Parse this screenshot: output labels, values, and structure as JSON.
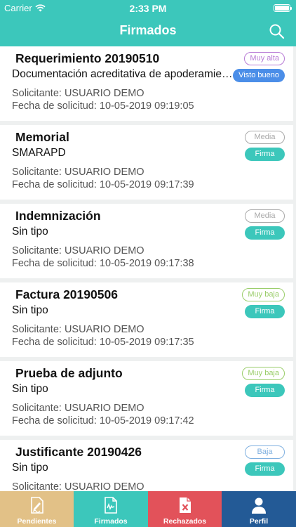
{
  "status_bar": {
    "carrier": "Carrier",
    "time": "2:33 PM"
  },
  "nav": {
    "title": "Firmados",
    "search_icon": "search-icon"
  },
  "colors": {
    "teal": "#3cc7bb",
    "blue": "#4b8ee8",
    "pendientes": "#e2c187",
    "firmados": "#3cc7bb",
    "rechazados": "#e2525a",
    "perfil": "#235a96",
    "muy_alta": "#b87cd6",
    "media": "#a8a8a8",
    "muy_baja": "#9acd6a",
    "baja": "#7fb0e0"
  },
  "documents": [
    {
      "title": "Requerimiento 20190510",
      "subtitle": "Documentación acreditativa de apoderamiento",
      "requester": "Solicitante: USUARIO DEMO",
      "date": "Fecha de solicitud: 10-05-2019 09:19:05",
      "priority": "Muy alta",
      "priority_color": "#b87cd6",
      "type": "Visto bueno",
      "type_color": "#4b8ee8"
    },
    {
      "title": "Memorial",
      "subtitle": "SMARAPD",
      "requester": "Solicitante: USUARIO DEMO",
      "date": "Fecha de solicitud: 10-05-2019 09:17:39",
      "priority": "Media",
      "priority_color": "#a8a8a8",
      "type": "Firma",
      "type_color": "#3cc7bb"
    },
    {
      "title": "Indemnización",
      "subtitle": "Sin tipo",
      "requester": "Solicitante: USUARIO DEMO",
      "date": "Fecha de solicitud: 10-05-2019 09:17:38",
      "priority": "Media",
      "priority_color": "#a8a8a8",
      "type": "Firma",
      "type_color": "#3cc7bb"
    },
    {
      "title": "Factura 20190506",
      "subtitle": "Sin tipo",
      "requester": "Solicitante: USUARIO DEMO",
      "date": "Fecha de solicitud: 10-05-2019 09:17:35",
      "priority": "Muy baja",
      "priority_color": "#9acd6a",
      "type": "Firma",
      "type_color": "#3cc7bb"
    },
    {
      "title": "Prueba de adjunto",
      "subtitle": "Sin tipo",
      "requester": "Solicitante: USUARIO DEMO",
      "date": "Fecha de solicitud: 10-05-2019 09:17:42",
      "priority": "Muy baja",
      "priority_color": "#9acd6a",
      "type": "Firma",
      "type_color": "#3cc7bb"
    },
    {
      "title": "Justificante 20190426",
      "subtitle": "Sin tipo",
      "requester": "Solicitante: USUARIO DEMO",
      "date": "",
      "priority": "Baja",
      "priority_color": "#7fb0e0",
      "type": "Firma",
      "type_color": "#3cc7bb"
    }
  ],
  "tabs": [
    {
      "label": "Pendientes",
      "icon": "pen-document-icon",
      "color": "#e2c187"
    },
    {
      "label": "Firmados",
      "icon": "signed-document-icon",
      "color": "#3cc7bb"
    },
    {
      "label": "Rechazados",
      "icon": "rejected-document-icon",
      "color": "#e2525a"
    },
    {
      "label": "Perfil",
      "icon": "user-icon",
      "color": "#235a96"
    }
  ]
}
